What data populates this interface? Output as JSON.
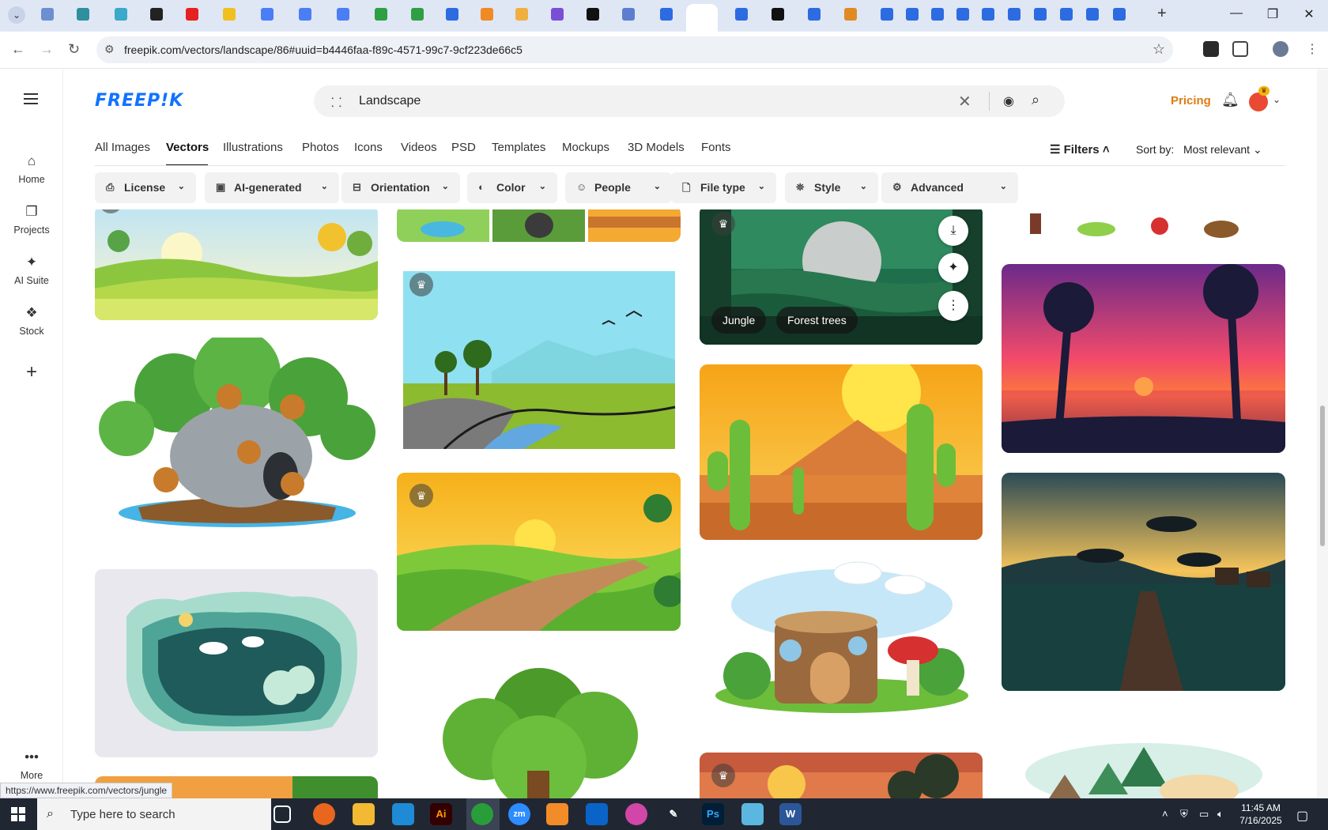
{
  "browser": {
    "url": "freepik.com/vectors/landscape/86#uuid=b4446faa-f89c-4571-99c7-9cf223de66c5",
    "tab_colors": [
      "#6b8fcf",
      "#2f8f9e",
      "#3ba9c9",
      "#222",
      "#e52222",
      "#f0c020",
      "#4b7ef5",
      "#4b7ef5",
      "#4b7ef5",
      "#2ea043",
      "#2ea043",
      "#2d6be0",
      "#f08a24",
      "#f0b040",
      "#7a4fd6",
      "#111",
      "#5d7ecf",
      "#2d6be0",
      "#2d6be0",
      "#2d6be0",
      "#111",
      "#2d6be0",
      "#e08a24",
      "#2d6be0",
      "#2d6be0",
      "#2d6be0",
      "#2d6be0",
      "#2d6be0",
      "#2d6be0",
      "#2d6be0",
      "#2d6be0",
      "#2d6be0",
      "#2d6be0"
    ]
  },
  "rail": {
    "items": [
      {
        "label": "Home",
        "icon": "house-icon"
      },
      {
        "label": "Projects",
        "icon": "folders-icon"
      },
      {
        "label": "AI Suite",
        "icon": "sparkle-icon"
      },
      {
        "label": "Stock",
        "icon": "stock-icon"
      }
    ],
    "more_label": "More"
  },
  "header": {
    "logo": "FREEP!K",
    "search_value": "Landscape",
    "pricing": "Pricing",
    "brand_color": "#1173ff",
    "pricing_color": "#e07b13"
  },
  "categories": [
    "All Images",
    "Vectors",
    "Illustrations",
    "Photos",
    "Icons",
    "Videos",
    "PSD",
    "Templates",
    "Mockups",
    "3D Models",
    "Fonts"
  ],
  "active_category": "Vectors",
  "toolbar": {
    "filters_label": "Filters",
    "sort_label": "Sort by:",
    "sort_value": "Most relevant"
  },
  "chips": [
    "License",
    "AI-generated",
    "Orientation",
    "Color",
    "People",
    "File type",
    "Style",
    "Advanced"
  ],
  "hovered_card": {
    "tags": [
      "Jungle",
      "Forest trees"
    ]
  },
  "status_url": "https://www.freepik.com/vectors/jungle",
  "taskbar": {
    "search_placeholder": "Type here to search",
    "time": "11:45 AM",
    "date": "7/16/2025"
  }
}
